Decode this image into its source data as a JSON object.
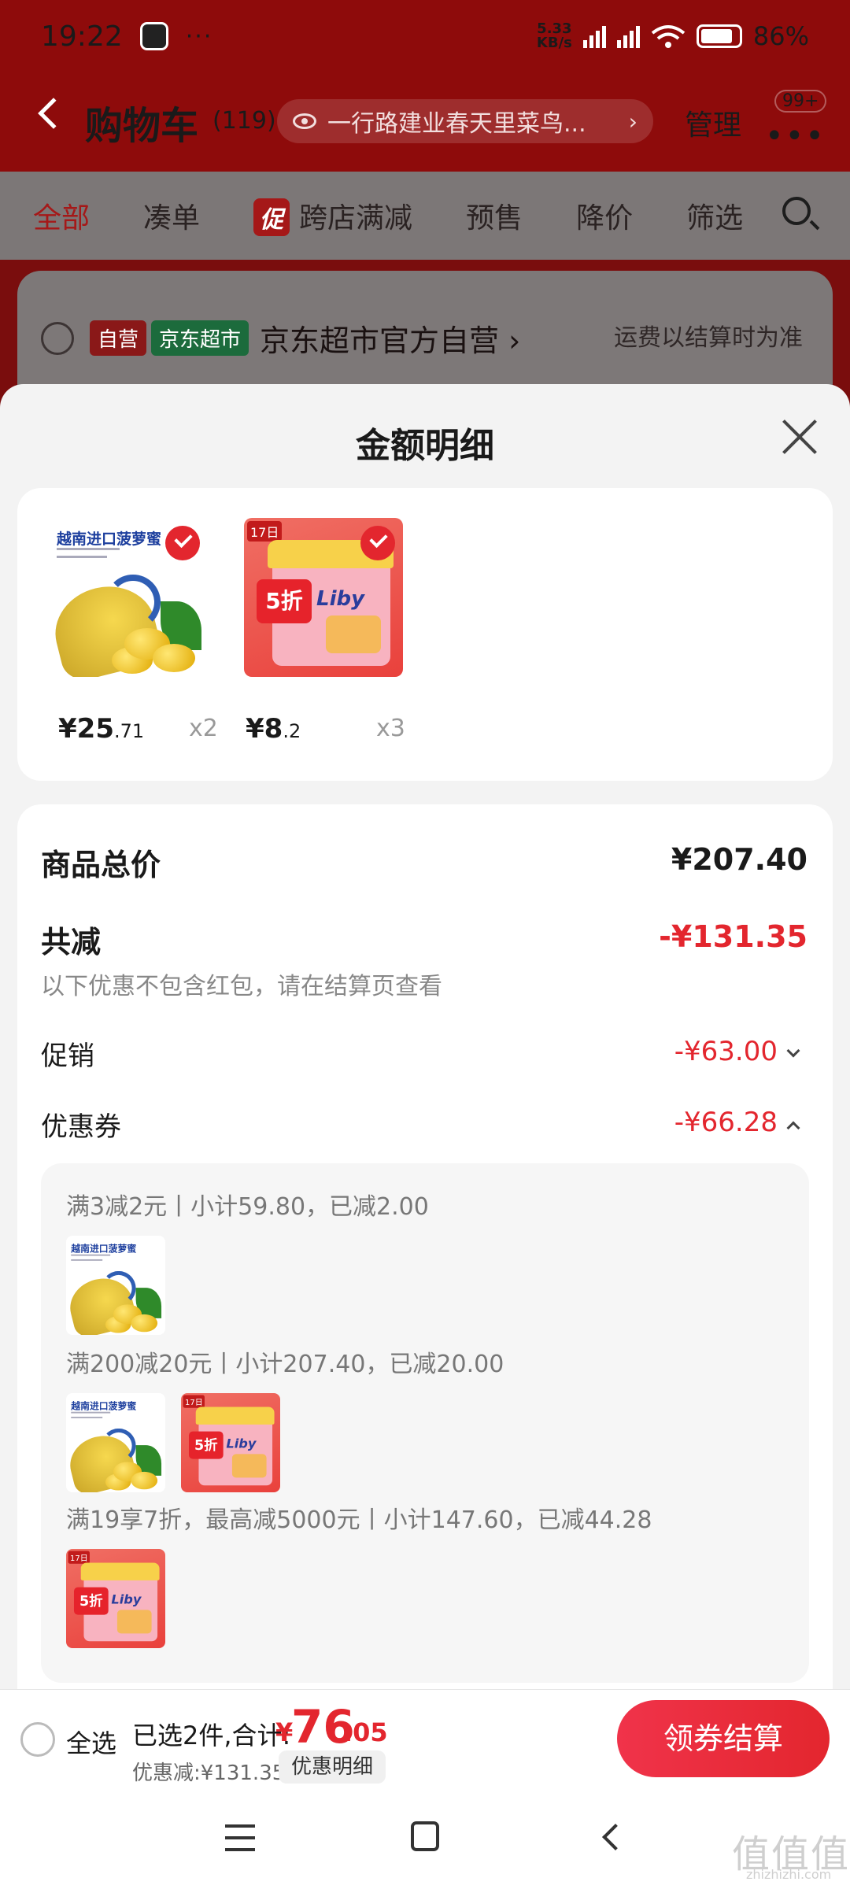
{
  "status_bar": {
    "time": "19:22",
    "more": "···",
    "net_speed": "5.33",
    "net_unit": "KB/s",
    "battery": "86%"
  },
  "header": {
    "title": "购物车",
    "count": "(119)",
    "address": "一行路建业春天里菜鸟...",
    "manage": "管理",
    "msg_badge": "99+"
  },
  "filters": {
    "all": "全部",
    "bundle": "凑单",
    "promo_tag": "促",
    "cross_store": "跨店满减",
    "presale": "预售",
    "price_drop": "降价",
    "filter": "筛选"
  },
  "store": {
    "tag_self": "自营",
    "tag_jd": "京东超市",
    "name": "京东超市官方自营 ›",
    "shipping_note": "运费以结算时为准"
  },
  "sheet": {
    "title": "金额明细",
    "items": [
      {
        "price_int": "¥25",
        "price_dec": ".71",
        "qty": "x2",
        "img_title": "越南进口菠萝蜜"
      },
      {
        "price_int": "¥8",
        "price_dec": ".2",
        "qty": "x3",
        "img_disc": "5折",
        "img_logo": "Liby",
        "img_tag": "17日"
      }
    ],
    "total_label": "商品总价",
    "total_value": "¥207.40",
    "reduce_label": "共减",
    "reduce_value": "-¥131.35",
    "reduce_note": "以下优惠不包含红包，请在结算页查看",
    "promo_label": "促销",
    "promo_value": "-¥63.00",
    "coupon_label": "优惠券",
    "coupon_value": "-¥66.28",
    "coupons": [
      {
        "text": "满3减2元丨小计59.80，已减2.00"
      },
      {
        "text": "满200减20元丨小计207.40，已减20.00"
      },
      {
        "text": "满19享7折，最高减5000元丨小计147.60，已减44.28"
      }
    ]
  },
  "bottom": {
    "select_all": "全选",
    "selected": "已选2件,合计:",
    "currency": "¥",
    "total_int": "76",
    "total_dec": ".05",
    "discount": "优惠减:¥131.35",
    "detail_button": "优惠明细",
    "checkout_button": "领券结算"
  },
  "watermark": {
    "main": "值值值",
    "sub": "zhizhizhi.com"
  },
  "colors": {
    "brand_red": "#e3262e",
    "header_red": "#8e0b0b",
    "dim_overlay": "#7c7777"
  }
}
